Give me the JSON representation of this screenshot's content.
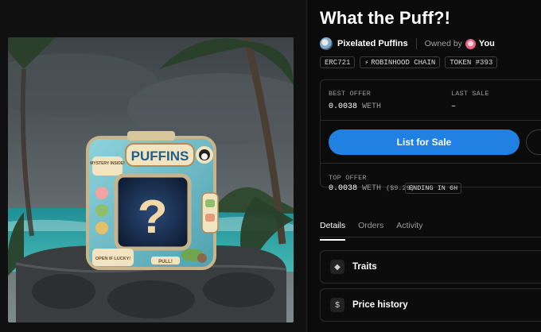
{
  "item": {
    "title": "What the Puff?!",
    "collection": "Pixelated Puffins",
    "owned_by_label": "Owned by",
    "owner": "You"
  },
  "tags": [
    {
      "label": "ERC721",
      "icon": ""
    },
    {
      "label": "ROBINHOOD CHAIN",
      "icon": "chain-icon"
    },
    {
      "label": "TOKEN #393",
      "icon": ""
    }
  ],
  "pricing": {
    "best_offer_label": "BEST OFFER",
    "best_offer_value": "0.0038",
    "best_offer_unit": "WETH",
    "last_sale_label": "LAST SALE",
    "last_sale_value": "–",
    "list_button": "List for Sale",
    "top_offer_label": "TOP OFFER",
    "top_offer_value": "0.0038",
    "top_offer_unit": "WETH",
    "top_offer_usd": "($9.29)",
    "ending_label": "ENDING IN 6H"
  },
  "tabs": [
    {
      "label": "Details",
      "active": true
    },
    {
      "label": "Orders",
      "active": false
    },
    {
      "label": "Activity",
      "active": false
    }
  ],
  "sections": [
    {
      "label": "Traits",
      "icon": "diamond-icon",
      "glyph": "◆"
    },
    {
      "label": "Price history",
      "icon": "dollar-icon",
      "glyph": "$"
    }
  ],
  "artwork": {
    "box_title": "PUFFINS",
    "mystery_label": "MYSTERY INSIDE!",
    "question_mark": "?",
    "pull_label": "PULL!",
    "open_label": "OPEN IF LUCKY!"
  },
  "colors": {
    "accent": "#2081e2",
    "box": "#7fc3cf",
    "sea": "#2fa5a8"
  }
}
